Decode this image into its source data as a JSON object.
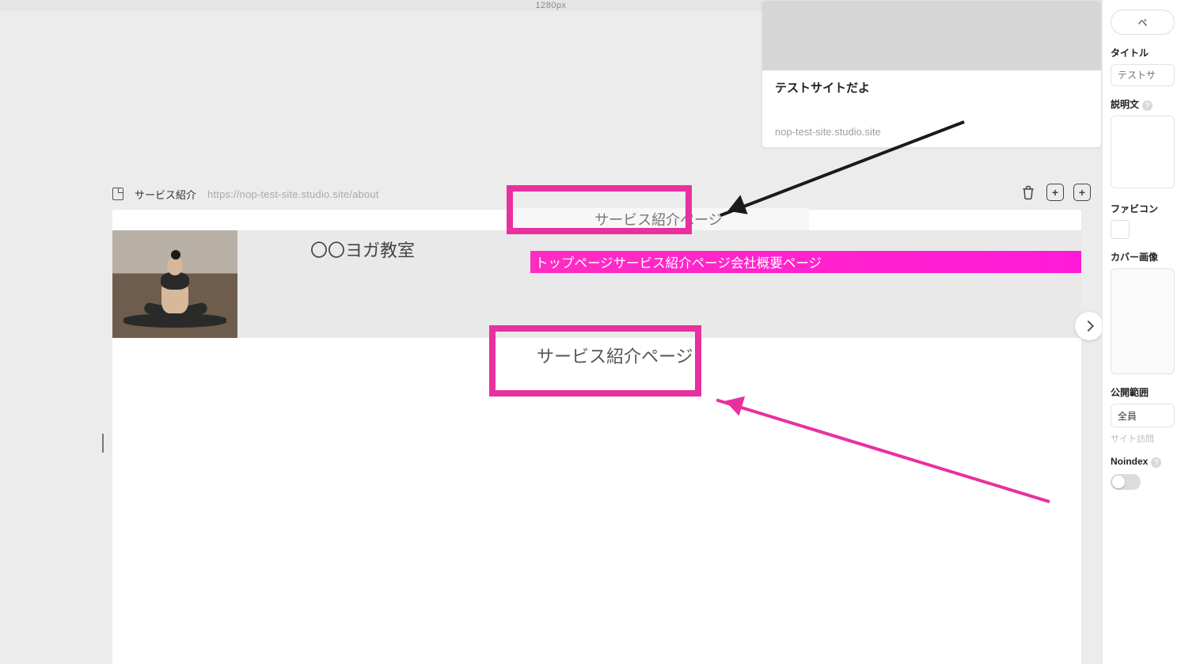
{
  "ruler": {
    "width_label": "1280px"
  },
  "preview": {
    "title": "テストサイトだよ",
    "url": "nop-test-site.studio.site"
  },
  "page_bar": {
    "name": "サービス紹介",
    "url": "https://nop-test-site.studio.site/about"
  },
  "site": {
    "tab_text": "サービス紹介ページ",
    "title": "〇〇ヨガ教室",
    "nav_text": "トップページサービス紹介ページ会社概要ページ",
    "h1": "サービス紹介ページ"
  },
  "panel": {
    "top_button": "ペ",
    "labels": {
      "title": "タイトル",
      "description": "説明文",
      "favicon": "ファビコン",
      "cover": "カバー画像",
      "visibility": "公開範囲",
      "noindex": "Noindex"
    },
    "title_placeholder": "テストサ",
    "visibility_value": "全員",
    "visibility_hint": "サイト訪問"
  }
}
